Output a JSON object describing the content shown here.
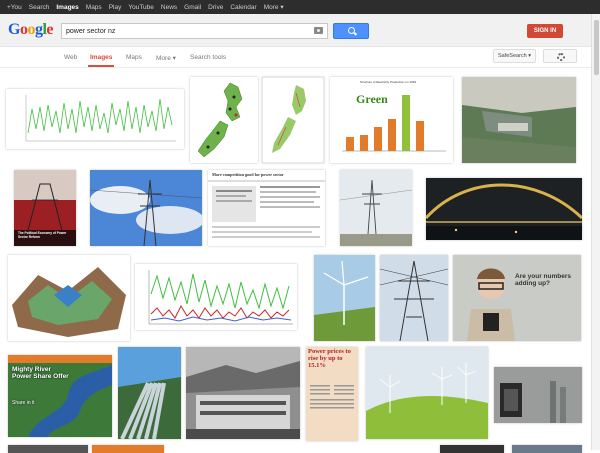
{
  "topbar": {
    "links": [
      "+You",
      "Search",
      "Images",
      "Maps",
      "Play",
      "YouTube",
      "News",
      "Gmail",
      "Drive",
      "Calendar",
      "More ▾"
    ],
    "active": "Images"
  },
  "header": {
    "logo": [
      "G",
      "o",
      "o",
      "g",
      "l",
      "e"
    ],
    "search_value": "power sector nz",
    "signin_label": "SIGN IN"
  },
  "nav": {
    "tabs": [
      "Web",
      "Images",
      "Maps",
      "More ▾",
      "Search tools"
    ],
    "active": "Images",
    "safesearch_label": "SafeSearch ▾"
  },
  "results": {
    "chart_caption": "Structure of Electricity Production on 1993",
    "chart_legend": "Green",
    "book_title": "The Political Economy of Power Sector Reform",
    "article_heading": "More competition good for power sector",
    "child_caption": "Are your numbers adding up?",
    "headline_power_sharing": "Mighty River Power Share Offer",
    "headline_power_sharing_sub": "Share in it",
    "newspaper_headline": "Power prices to rise by up to 15.1%",
    "colors": {
      "green": "#3fbf3f",
      "red": "#dd4b39",
      "blue": "#4d90fe",
      "orange": "#e27b2a"
    }
  }
}
